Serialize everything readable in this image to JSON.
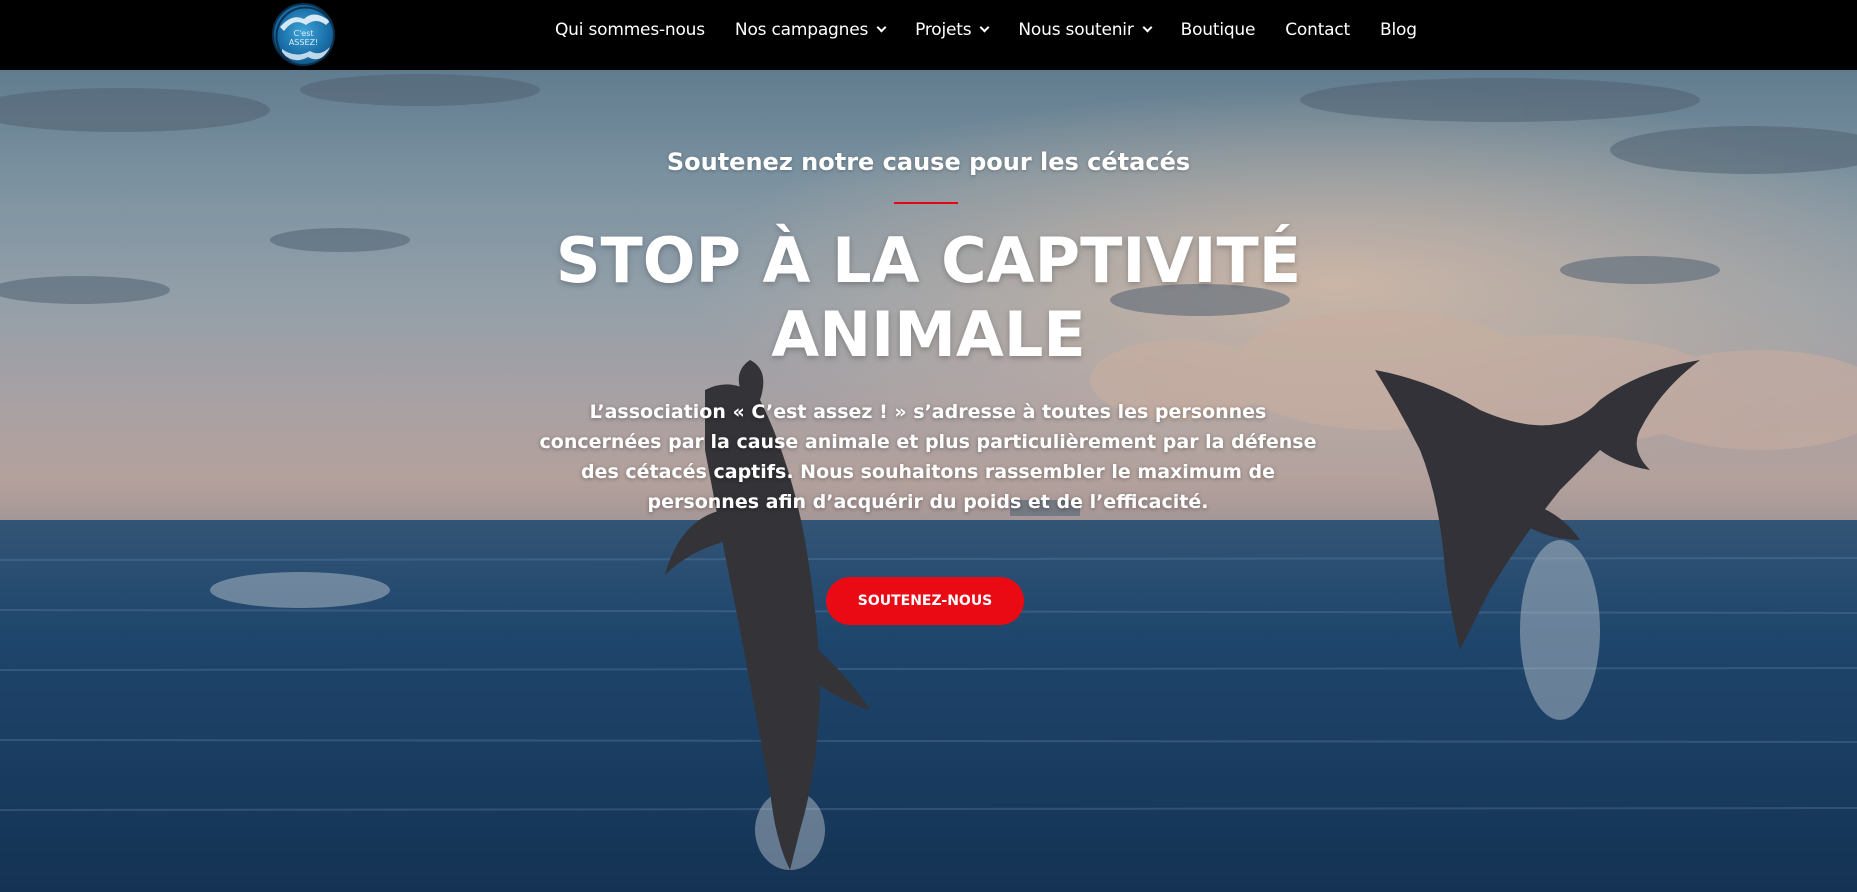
{
  "header": {
    "logo_text_line1": "C'est",
    "logo_text_line2": "ASSEZ!",
    "nav": [
      {
        "label": "Qui sommes-nous",
        "dropdown": false
      },
      {
        "label": "Nos campagnes",
        "dropdown": true
      },
      {
        "label": "Projets",
        "dropdown": true
      },
      {
        "label": "Nous soutenir",
        "dropdown": true
      },
      {
        "label": "Boutique",
        "dropdown": false
      },
      {
        "label": "Contact",
        "dropdown": false
      },
      {
        "label": "Blog",
        "dropdown": false
      }
    ]
  },
  "hero": {
    "subtitle": "Soutenez notre cause pour les cétacés",
    "headline_line1": "STOP À LA CAPTIVITÉ",
    "headline_line2": "ANIMALE",
    "body": "L’association « C’est assez ! » s’adresse à toutes les personnes concernées par la cause animale et plus particulièrement par la défense des cétacés captifs. Nous souhaitons rassembler le maximum de personnes afin d’acquérir du poids et de l’efficacité.",
    "cta_label": "SOUTENEZ-NOUS",
    "background_image": "two dolphins leaping out of the ocean at sunset"
  },
  "colors": {
    "nav_bg": "#000000",
    "accent_red": "#e30613",
    "cta_bg": "#ea0a14",
    "text_white": "#ffffff"
  }
}
